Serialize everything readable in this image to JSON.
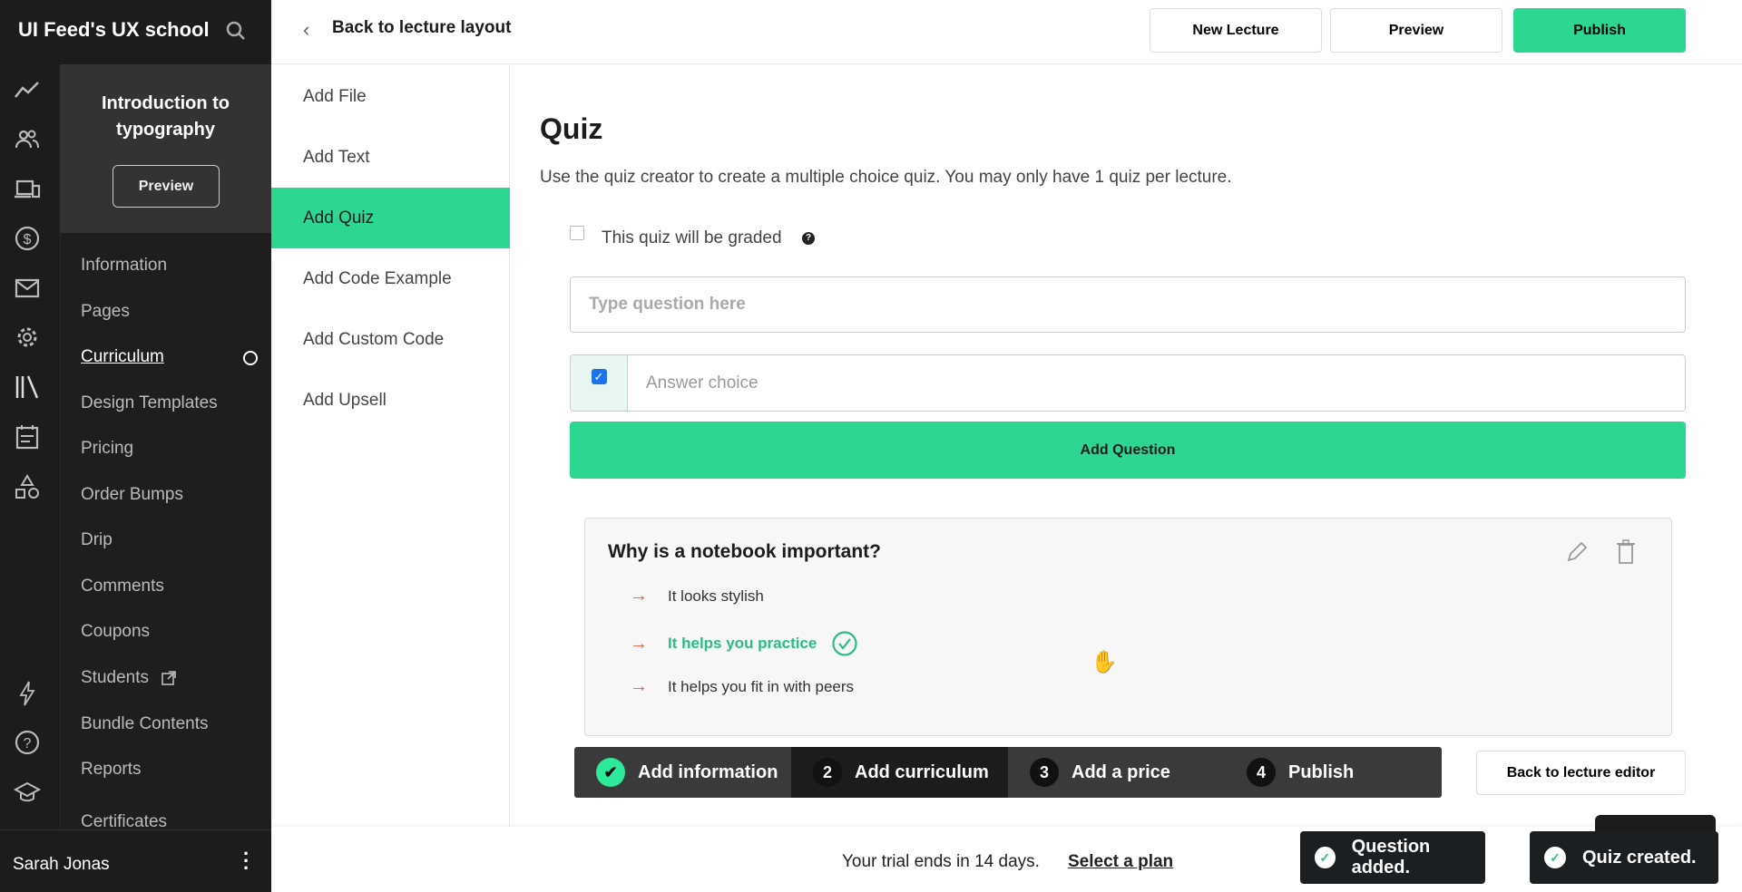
{
  "app": {
    "title": "UI Feed's UX school"
  },
  "course": {
    "title": "Introduction to typography",
    "preview_label": "Preview"
  },
  "rail_icons": [
    "analytics-icon",
    "users-icon",
    "devices-icon",
    "dollar-icon",
    "mail-icon",
    "gear-icon",
    "library-icon",
    "calendar-icon",
    "shapes-icon",
    "lightning-icon",
    "help-icon",
    "graduation-cap-icon"
  ],
  "sidebar": {
    "items": [
      {
        "label": "Information"
      },
      {
        "label": "Pages"
      },
      {
        "label": "Curriculum",
        "active": true
      },
      {
        "label": "Design Templates"
      },
      {
        "label": "Pricing"
      },
      {
        "label": "Order Bumps"
      },
      {
        "label": "Drip"
      },
      {
        "label": "Comments"
      },
      {
        "label": "Coupons"
      },
      {
        "label": "Students"
      },
      {
        "label": "Bundle Contents"
      },
      {
        "label": "Reports"
      },
      {
        "label": "Certificates"
      }
    ]
  },
  "user": {
    "name": "Sarah Jonas"
  },
  "header": {
    "back_label": "Back to lecture layout",
    "new_lecture": "New Lecture",
    "preview": "Preview",
    "publish": "Publish"
  },
  "content_menu": {
    "items": [
      {
        "label": "Add File"
      },
      {
        "label": "Add Text"
      },
      {
        "label": "Add Quiz",
        "active": true
      },
      {
        "label": "Add Code Example"
      },
      {
        "label": "Add Custom Code"
      },
      {
        "label": "Add Upsell"
      }
    ]
  },
  "quiz": {
    "title": "Quiz",
    "description": "Use the quiz creator to create a multiple choice quiz. You may only have 1 quiz per lecture.",
    "graded_label": "This quiz will be graded",
    "graded": false,
    "question_placeholder": "Type question here",
    "answer_placeholder": "Answer choice",
    "answer_checked": true,
    "add_question": "Add Question",
    "card": {
      "question": "Why is a notebook important?",
      "answers": [
        {
          "text": "It looks stylish",
          "correct": false
        },
        {
          "text": "It helps you practice",
          "correct": true
        },
        {
          "text": "It helps you fit in with peers",
          "correct": false
        }
      ]
    }
  },
  "steps": [
    {
      "num": "✔",
      "label": "Add information",
      "state": "done"
    },
    {
      "num": "2",
      "label": "Add curriculum",
      "state": "current"
    },
    {
      "num": "3",
      "label": "Add a price",
      "state": "todo"
    },
    {
      "num": "4",
      "label": "Publish",
      "state": "todo"
    }
  ],
  "back_editor": "Back to lecture editor",
  "trial": {
    "text": "Your trial ends in 14 days.",
    "link": "Select a plan"
  },
  "toasts": [
    {
      "text": "Question added."
    },
    {
      "text": "Quiz created."
    }
  ],
  "colors": {
    "accent": "#2dd691",
    "dark": "#1c1c1c",
    "correct": "#2dbd85"
  }
}
